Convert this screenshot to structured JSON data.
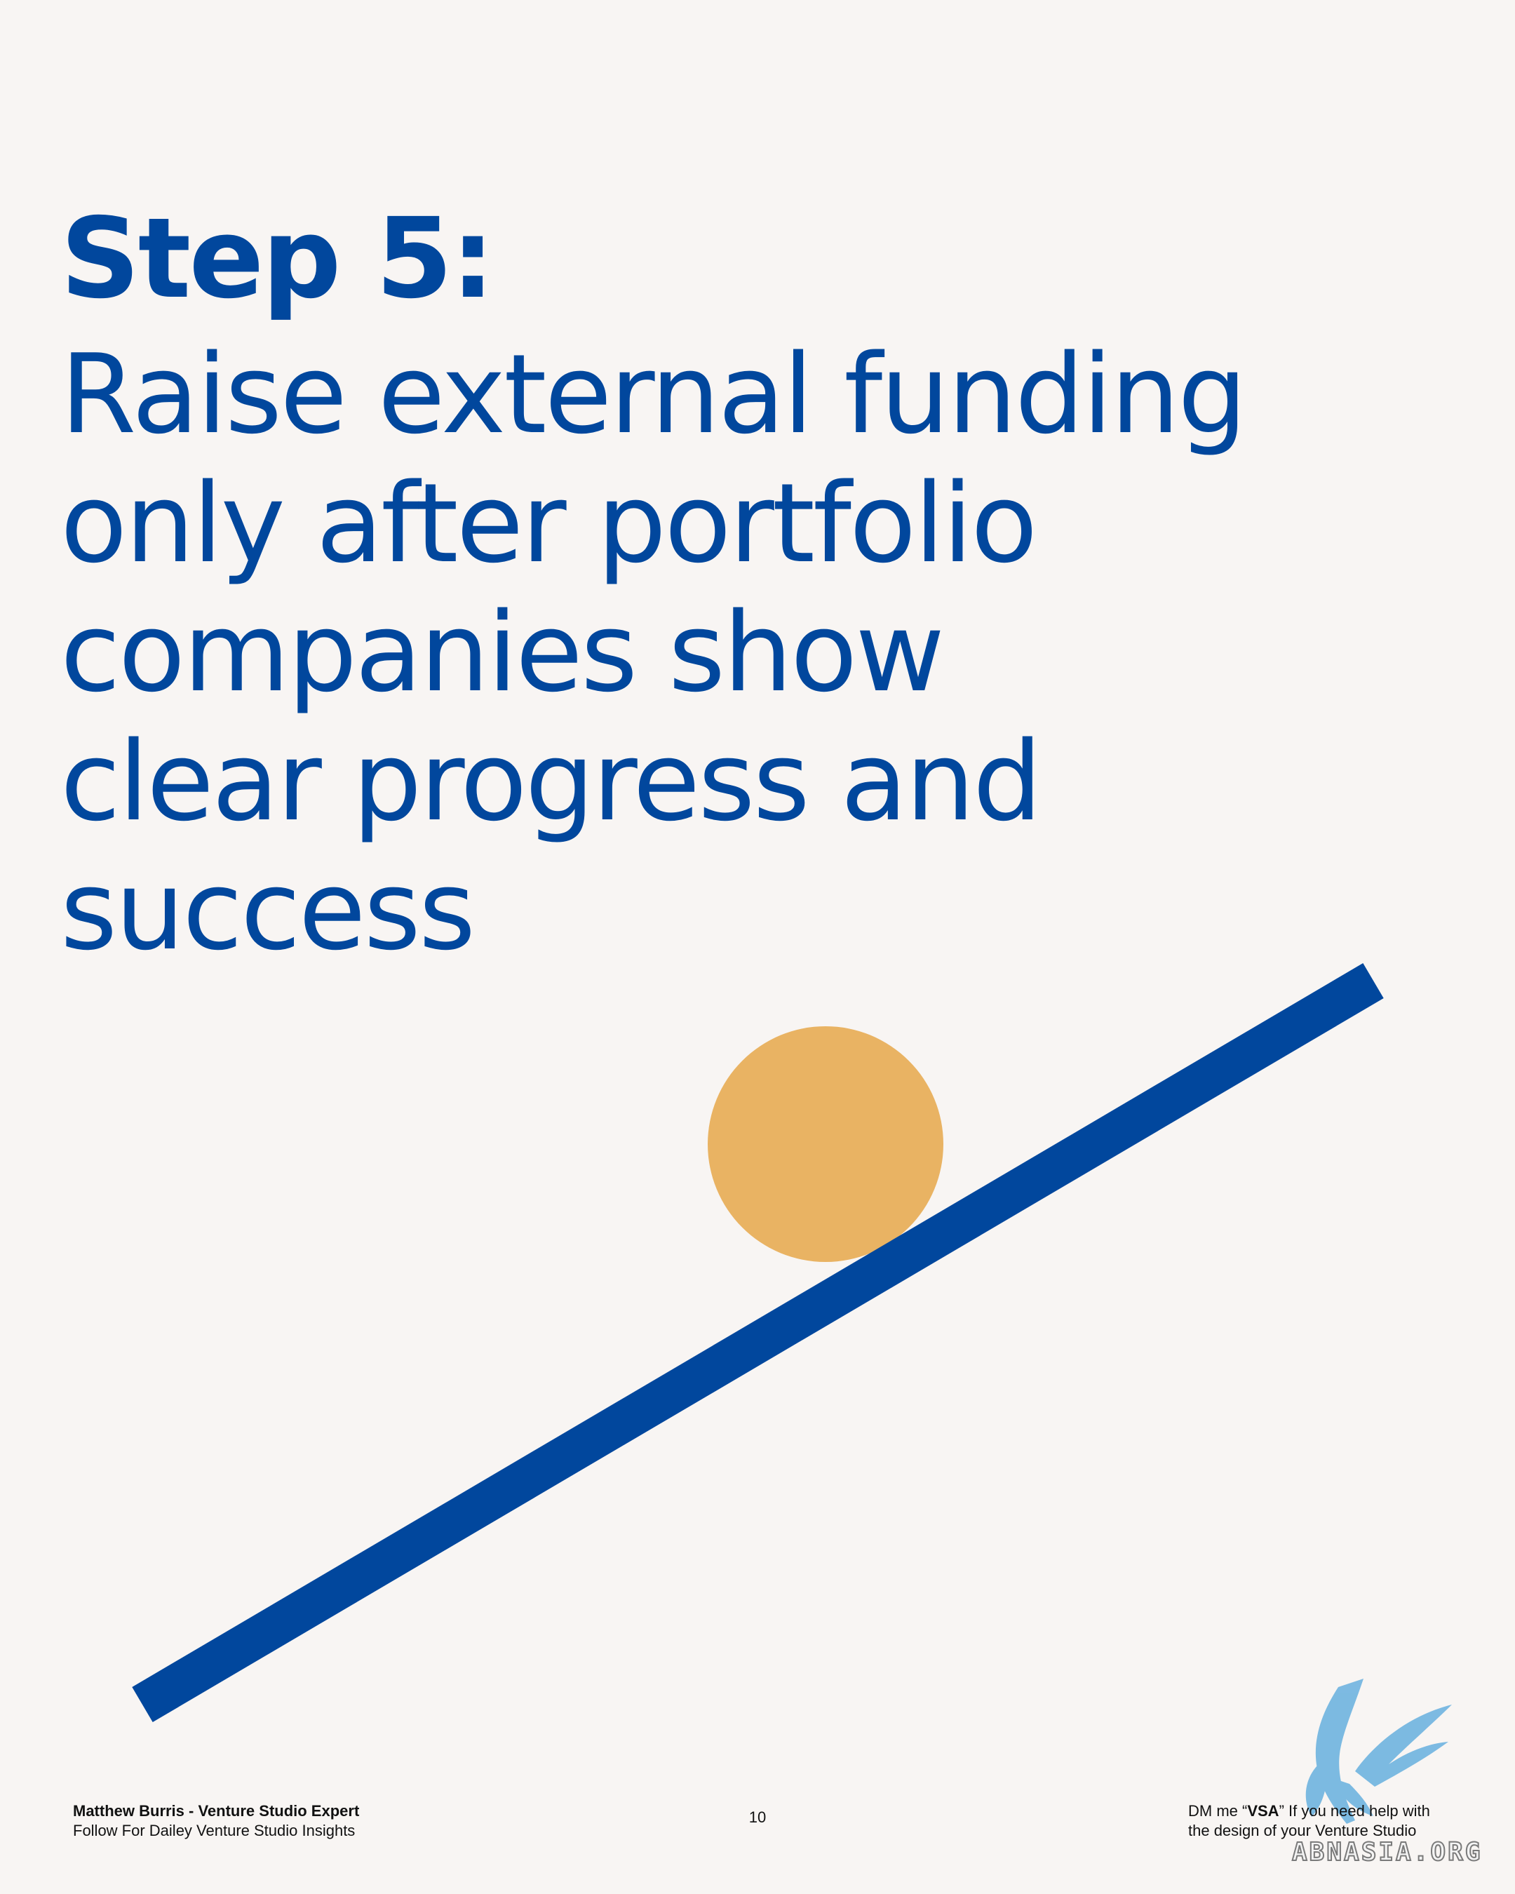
{
  "headline": {
    "step": "Step 5:",
    "lines": [
      "Raise external funding",
      "only after portfolio",
      "companies show",
      "clear progress and",
      "success"
    ]
  },
  "footer": {
    "author": "Matthew Burris - Venture Studio Expert",
    "tagline": "Follow For Dailey Venture Studio Insights",
    "page_number": "10",
    "dm_prefix": "DM me “",
    "dm_keyword": "VSA",
    "dm_suffix": "” If you need help with",
    "dm_line2": "the design of your Venture Studio"
  },
  "watermark": {
    "text": "ABNASIA.ORG"
  },
  "colors": {
    "background": "#f8f5f3",
    "accent_blue": "#01479d",
    "accent_orange": "#e9b363",
    "watermark_blue": "#6fb4e0"
  },
  "icons": {
    "watermark_logo": "bird-logo-icon",
    "illustration": "ball-on-ramp-illustration"
  }
}
